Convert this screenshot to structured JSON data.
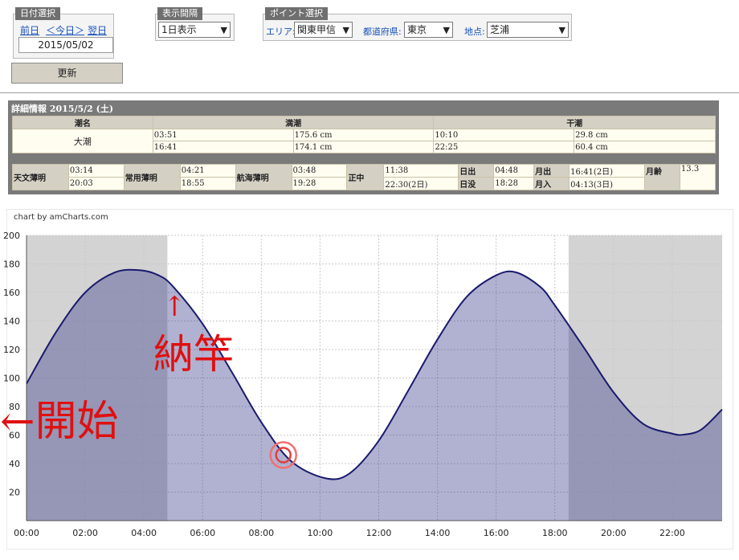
{
  "date_panel": {
    "tab": "日付選択",
    "prev": "前日",
    "today": "＜今日＞",
    "next": "翌日",
    "date": "2015/05/02"
  },
  "interval_panel": {
    "tab": "表示間隔",
    "value": "1日表示"
  },
  "point_panel": {
    "tab": "ポイント選択",
    "area_label": "エリア:",
    "area_value": "関東甲信",
    "pref_label": "都道府県:",
    "pref_value": "東京",
    "place_label": "地点:",
    "place_value": "芝浦"
  },
  "update_button": "更新",
  "detail": {
    "title": "詳細情報 2015/5/2 (土)",
    "header": {
      "tide_name": "潮名",
      "high": "満潮",
      "low": "干潮"
    },
    "tide_name": "大潮",
    "high_rows": [
      [
        "03:51",
        "175.6 cm"
      ],
      [
        "16:41",
        "174.1 cm"
      ]
    ],
    "low_rows": [
      [
        "10:10",
        "29.8 cm"
      ],
      [
        "22:25",
        "60.4 cm"
      ]
    ],
    "astro": {
      "astro_twilight": {
        "label": "天文薄明",
        "v1": "03:14",
        "v2": "20:03"
      },
      "civil_twilight": {
        "label": "常用薄明",
        "v1": "04:21",
        "v2": "18:55"
      },
      "nautical_twilight": {
        "label": "航海薄明",
        "v1": "03:48",
        "v2": "19:28"
      },
      "culmination": {
        "label": "正中",
        "v1": "11:38",
        "v2": "22:30(2日)"
      },
      "sunrise": {
        "label": "日出",
        "value": "04:48"
      },
      "sunset": {
        "label": "日没",
        "value": "18:28"
      },
      "moonset": {
        "label": "月出",
        "value": "16:41(2日)"
      },
      "moonrise": {
        "label": "月入",
        "value": "04:13(3日)"
      },
      "moon_age": {
        "label": "月齢",
        "value": "13.3"
      }
    }
  },
  "chart_credit": "chart by amCharts.com",
  "annotations": {
    "start": "←開始",
    "finish": "納竿",
    "arrow": "↑"
  },
  "chart_data": {
    "type": "area",
    "x_unit": "hour of day",
    "xlim": [
      0,
      23.7
    ],
    "ylim": [
      0,
      200
    ],
    "yticks": [
      20,
      40,
      60,
      80,
      100,
      120,
      140,
      160,
      180,
      200
    ],
    "xticks": [
      "00:00",
      "02:00",
      "04:00",
      "06:00",
      "08:00",
      "10:00",
      "12:00",
      "14:00",
      "16:00",
      "18:00",
      "20:00",
      "22:00"
    ],
    "grid": true,
    "night_shading": [
      [
        0,
        4.8
      ],
      [
        18.47,
        23.7
      ]
    ],
    "colors": {
      "line": "#1a1a6e",
      "fill": "#aeb0d6",
      "night": "#d3d3d3"
    },
    "series": [
      {
        "x": [
          0,
          1,
          2,
          3,
          3.85,
          4.5,
          5,
          6,
          7,
          8,
          9,
          10.17,
          11,
          12,
          13,
          14,
          15,
          16,
          16.68,
          17.5,
          18,
          19,
          20,
          21,
          22,
          22.42,
          23,
          23.7
        ],
        "values": [
          96,
          132,
          160,
          174,
          175.6,
          172,
          164,
          138,
          104,
          69,
          42,
          29.8,
          33,
          56,
          91,
          127,
          157,
          172,
          174.1,
          164,
          151,
          121,
          90,
          68,
          61,
          60.4,
          64,
          78
        ]
      }
    ],
    "marker": {
      "x": 8.75,
      "y": 46
    }
  }
}
